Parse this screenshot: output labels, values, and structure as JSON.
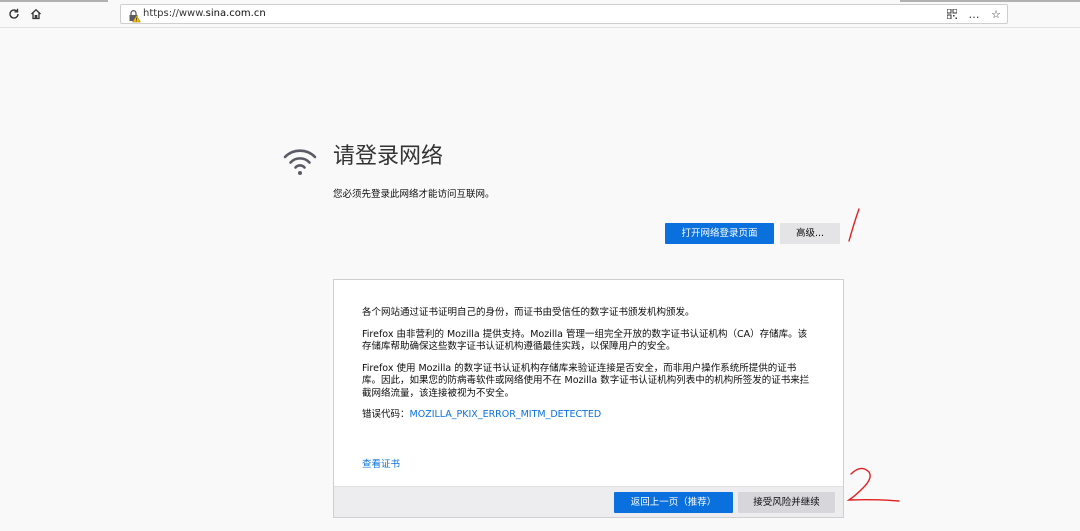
{
  "toolbar": {
    "url_prefix": "https://www.",
    "url_domain": "sina.com.cn",
    "reload_icon": "reload-icon",
    "home_icon": "home-icon",
    "qr_icon": "qr-code-icon",
    "more_icon": "…",
    "bookmark_icon": "☆"
  },
  "main": {
    "title": "请登录网络",
    "subtitle": "您必须先登录此网络才能访问互联网。",
    "open_login_label": "打开网络登录页面",
    "advanced_label": "高级..."
  },
  "advanced_panel": {
    "para1": "各个网站通过证书证明自己的身份，而证书由受信任的数字证书颁发机构颁发。",
    "para2": "Firefox 由非营利的 Mozilla 提供支持。Mozilla 管理一组完全开放的数字证书认证机构（CA）存储库。该存储库帮助确保这些数字证书认证机构遵循最佳实践，以保障用户的安全。",
    "para3": "Firefox 使用 Mozilla 的数字证书认证机构存储库来验证连接是否安全，而非用户操作系统所提供的证书库。因此，如果您的防病毒软件或网络使用不在 Mozilla 数字证书认证机构列表中的机构所签发的证书来拦截网络流量，该连接被视为不安全。",
    "error_label": "错误代码：",
    "error_code": "MOZILLA_PKIX_ERROR_MITM_DETECTED",
    "view_cert_label": "查看证书",
    "back_label": "返回上一页（推荐）",
    "accept_label": "接受风险并继续"
  },
  "annotations": {
    "mark1": "1",
    "mark2": "2",
    "color": "#e02020"
  },
  "colors": {
    "accent": "#0a70dd",
    "background": "#f9f9fa"
  }
}
